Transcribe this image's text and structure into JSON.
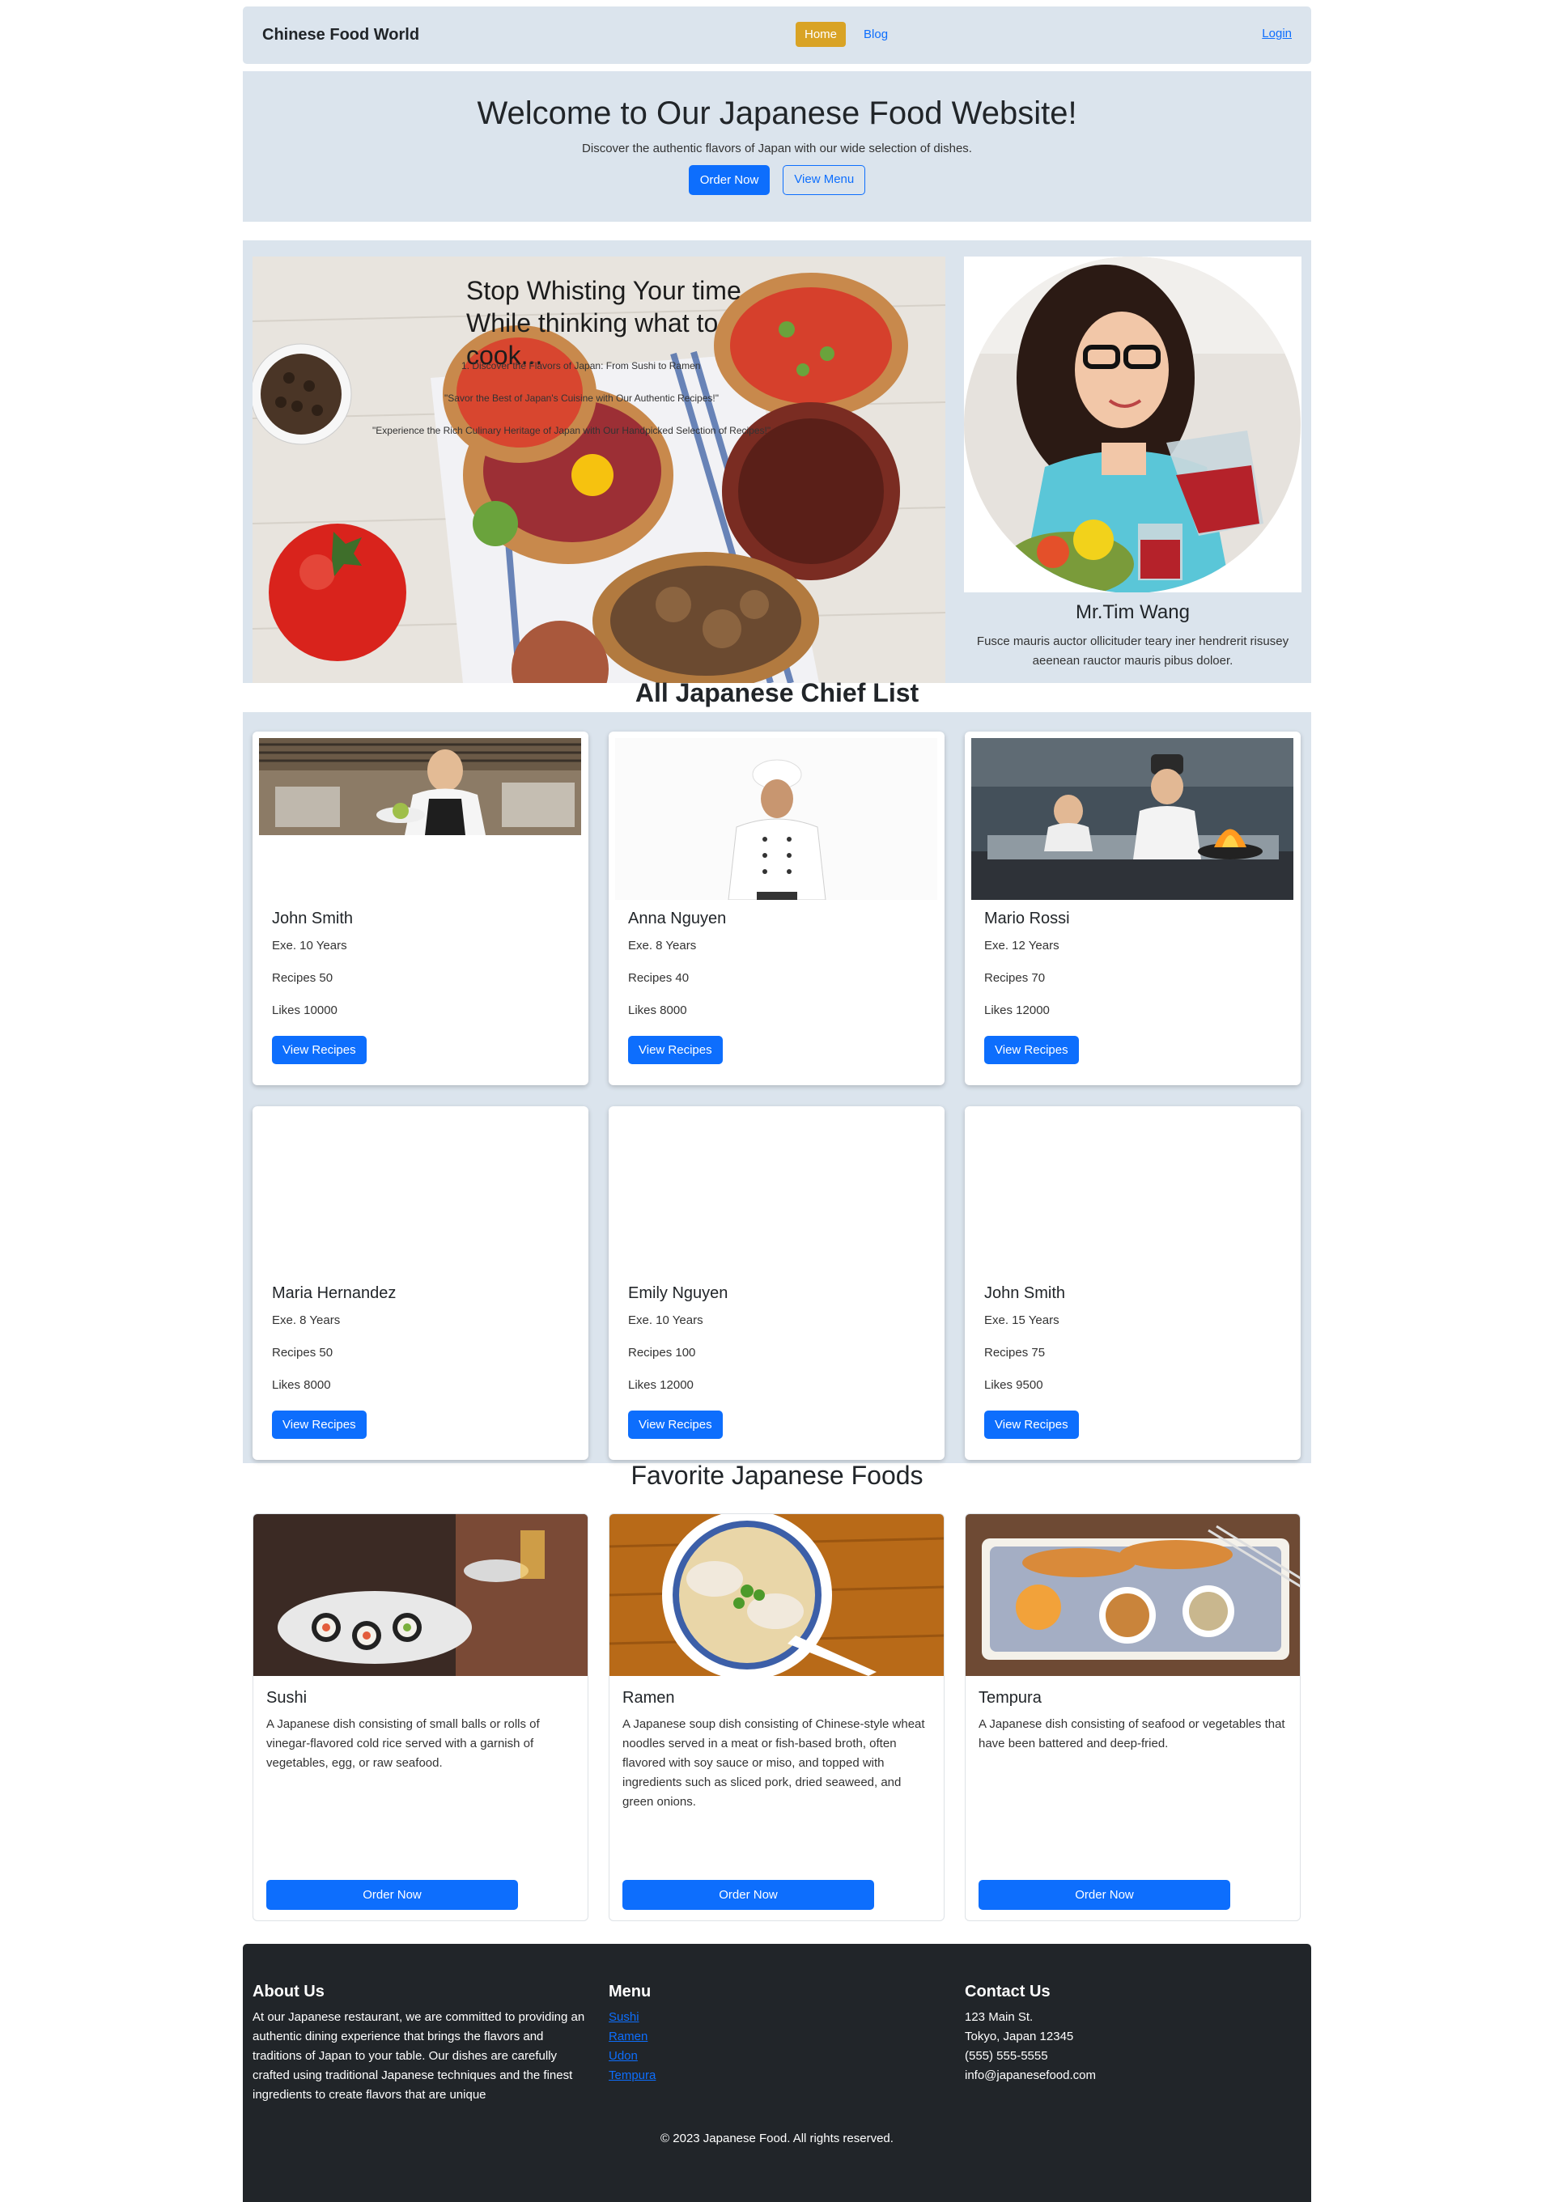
{
  "navbar": {
    "brand": "Chinese Food World",
    "home": "Home",
    "blog": "Blog",
    "login": "Login"
  },
  "hero": {
    "title": "Welcome to Our Japanese Food Website!",
    "subtitle": "Discover the authentic flavors of Japan with our wide selection of dishes.",
    "order_btn": "Order Now",
    "menu_btn": "View Menu"
  },
  "feature": {
    "title": "Stop Whisting Your time While thinking what to cook...",
    "line1": "1. Discover the Flavors of Japan: From Sushi to Ramen",
    "line2": "\"Savor the Best of Japan's Cuisine with Our Authentic Recipes!\"",
    "line3": "\"Experience the Rich Culinary Heritage of Japan with Our Handpicked Selection of Recipes!\"",
    "person_name": "Mr.Tim Wang",
    "person_desc": "Fusce mauris auctor ollicituder teary iner hendrerit risusey aeenean rauctor mauris pibus doloer."
  },
  "chief_section": {
    "title": "All Japanese Chief List",
    "chiefs": [
      {
        "name": "John Smith",
        "exp": "Exe. 10 Years",
        "recipes": "Recipes 50",
        "likes": "Likes 10000",
        "btn": "View Recipes"
      },
      {
        "name": "Anna Nguyen",
        "exp": "Exe. 8 Years",
        "recipes": "Recipes 40",
        "likes": "Likes 8000",
        "btn": "View Recipes"
      },
      {
        "name": "Mario Rossi",
        "exp": "Exe. 12 Years",
        "recipes": "Recipes 70",
        "likes": "Likes 12000",
        "btn": "View Recipes"
      },
      {
        "name": "Maria Hernandez",
        "exp": "Exe. 8 Years",
        "recipes": "Recipes 50",
        "likes": "Likes 8000",
        "btn": "View Recipes"
      },
      {
        "name": "Emily Nguyen",
        "exp": "Exe. 10 Years",
        "recipes": "Recipes 100",
        "likes": "Likes 12000",
        "btn": "View Recipes"
      },
      {
        "name": "John Smith",
        "exp": "Exe. 15 Years",
        "recipes": "Recipes 75",
        "likes": "Likes 9500",
        "btn": "View Recipes"
      }
    ]
  },
  "favorites": {
    "title": "Favorite Japanese Foods",
    "foods": [
      {
        "name": "Sushi",
        "desc": "A Japanese dish consisting of small balls or rolls of vinegar-flavored cold rice served with a garnish of vegetables, egg, or raw seafood.",
        "btn": "Order Now"
      },
      {
        "name": "Ramen",
        "desc": "A Japanese soup dish consisting of Chinese-style wheat noodles served in a meat or fish-based broth, often flavored with soy sauce or miso, and topped with ingredients such as sliced pork, dried seaweed, and green onions.",
        "btn": "Order Now"
      },
      {
        "name": "Tempura",
        "desc": "A Japanese dish consisting of seafood or vegetables that have been battered and deep-fried.",
        "btn": "Order Now"
      }
    ]
  },
  "footer": {
    "about_title": "About Us",
    "about_text": "At our Japanese restaurant, we are committed to providing an authentic dining experience that brings the flavors and traditions of Japan to your table. Our dishes are carefully crafted using traditional Japanese techniques and the finest ingredients to create flavors that are unique",
    "menu_title": "Menu",
    "menu_items": [
      "Sushi",
      "Ramen",
      "Udon",
      "Tempura"
    ],
    "contact_title": "Contact Us",
    "contact_lines": [
      "123 Main St.",
      "Tokyo, Japan 12345",
      "(555) 555-5555",
      "info@japanesefood.com"
    ],
    "copyright": "© 2023 Japanese Food. All rights reserved."
  },
  "colors": {
    "accent": "#0d6efd",
    "home_button": "#d9a325",
    "section_bg": "#dbe4ed",
    "footer_bg": "#212529"
  }
}
